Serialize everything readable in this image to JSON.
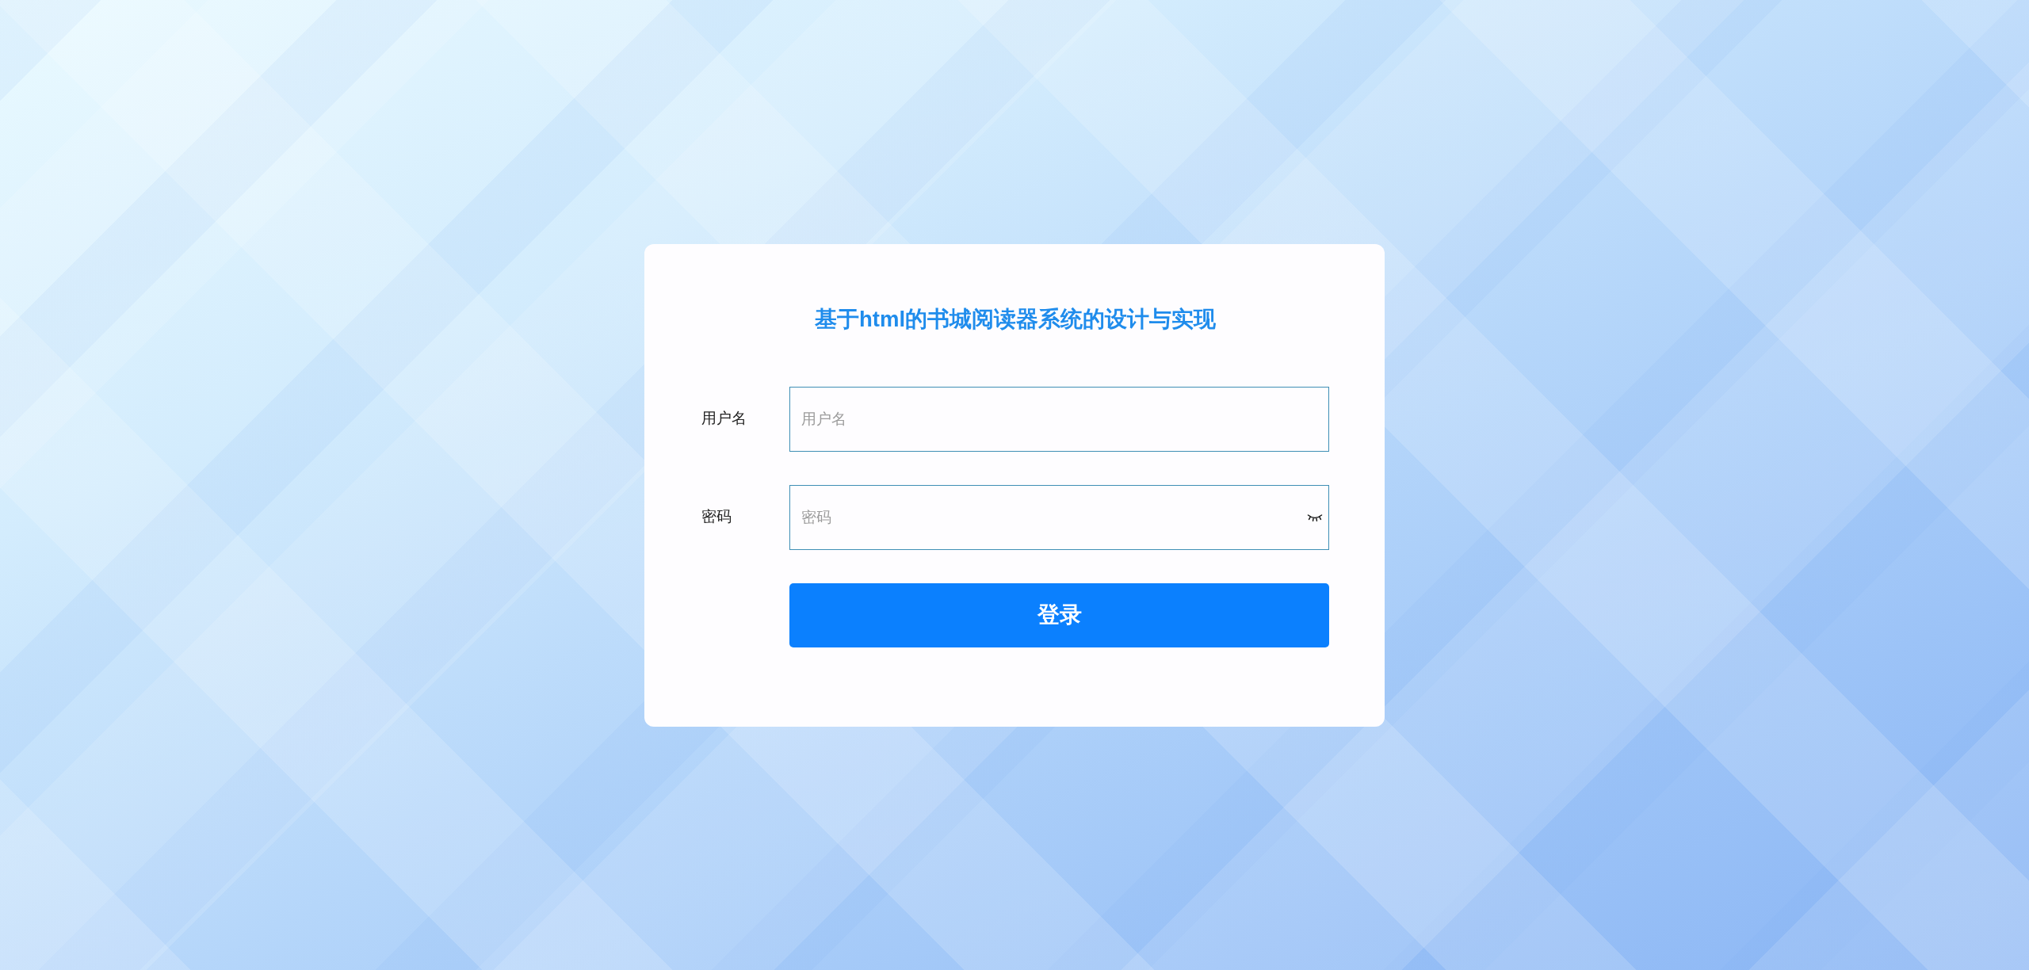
{
  "title": "基于html的书城阅读器系统的设计与实现",
  "fields": [
    {
      "kind": "text",
      "label": "用户名",
      "placeholder": "用户名"
    },
    {
      "kind": "password",
      "label": "密码",
      "placeholder": "密码"
    }
  ],
  "submit_button": {
    "label": "登录"
  }
}
